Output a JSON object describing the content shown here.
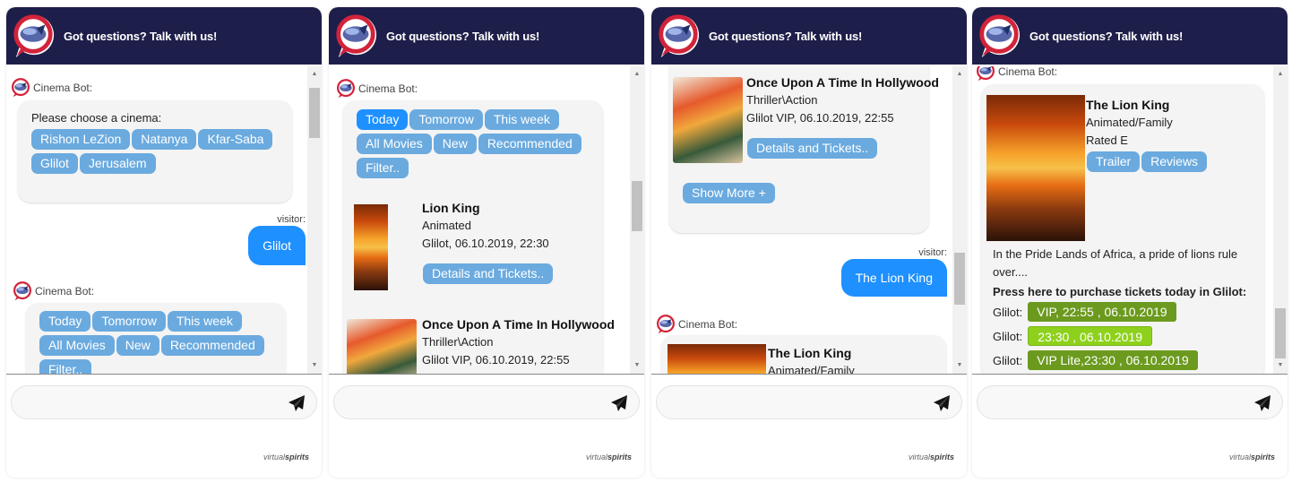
{
  "header": {
    "title": "Got questions? Talk with us!"
  },
  "bot_name": "Cinema Bot:",
  "visitor_name": "visitor:",
  "brand": {
    "light": "virtual",
    "bold": "spirits"
  },
  "colors": {
    "header_bg": "#1e1e4a",
    "chip": "#6aaadf",
    "chip_active": "#1e90ff",
    "visitor_bubble": "#1e90ff",
    "ticket_dark": "#6b9a1e",
    "ticket_light": "#8ed11c",
    "logo_red": "#d2233a"
  },
  "input": {
    "placeholder": "",
    "send_icon": "paper-plane-icon"
  },
  "panels": [
    {
      "cinema_prompt": "Please choose a cinema:",
      "cinemas": [
        "Rishon LeZion",
        "Natanya",
        "Kfar-Saba",
        "Glilot",
        "Jerusalem"
      ],
      "visitor_message": "Glilot",
      "filters": [
        "Today",
        "Tomorrow",
        "This week",
        "All Movies",
        "New",
        "Recommended",
        "Filter.."
      ]
    },
    {
      "filters": [
        "Today",
        "Tomorrow",
        "This week",
        "All Movies",
        "New",
        "Recommended",
        "Filter.."
      ],
      "active_filter": "Today",
      "movies": [
        {
          "title": "Lion King",
          "genre": "Animated",
          "showtime": "Glilot, 06.10.2019, 22:30",
          "button": "Details and Tickets.."
        },
        {
          "title": "Once Upon A Time In Hollywood",
          "genre": "Thriller\\Action",
          "showtime": "Glilot VIP, 06.10.2019, 22:55"
        }
      ]
    },
    {
      "movies": [
        {
          "title": "Once Upon A Time In Hollywood",
          "genre": "Thriller\\Action",
          "showtime": "Glilot VIP, 06.10.2019, 22:55",
          "button": "Details and Tickets.."
        }
      ],
      "show_more": "Show More +",
      "visitor_message": "The Lion King",
      "next_movie": {
        "title": "The Lion King",
        "genre": "Animated/Family"
      }
    },
    {
      "movie": {
        "title": "The Lion King",
        "genre": "Animated/Family",
        "rating": "Rated E",
        "buttons": [
          "Trailer",
          "Reviews"
        ]
      },
      "synopsis": "In the Pride Lands of Africa, a pride of lions rule over....",
      "purchase_prompt": "Press here to purchase tickets today in Glilot:",
      "tickets": [
        {
          "location": "Glilot:",
          "label": "VIP, 22:55 , 06.10.2019",
          "style": "dark"
        },
        {
          "location": "Glilot:",
          "label": "23:30 , 06.10.2019",
          "style": "light"
        },
        {
          "location": "Glilot:",
          "label": "VIP Lite,23:30 , 06.10.2019",
          "style": "dark"
        }
      ]
    }
  ]
}
